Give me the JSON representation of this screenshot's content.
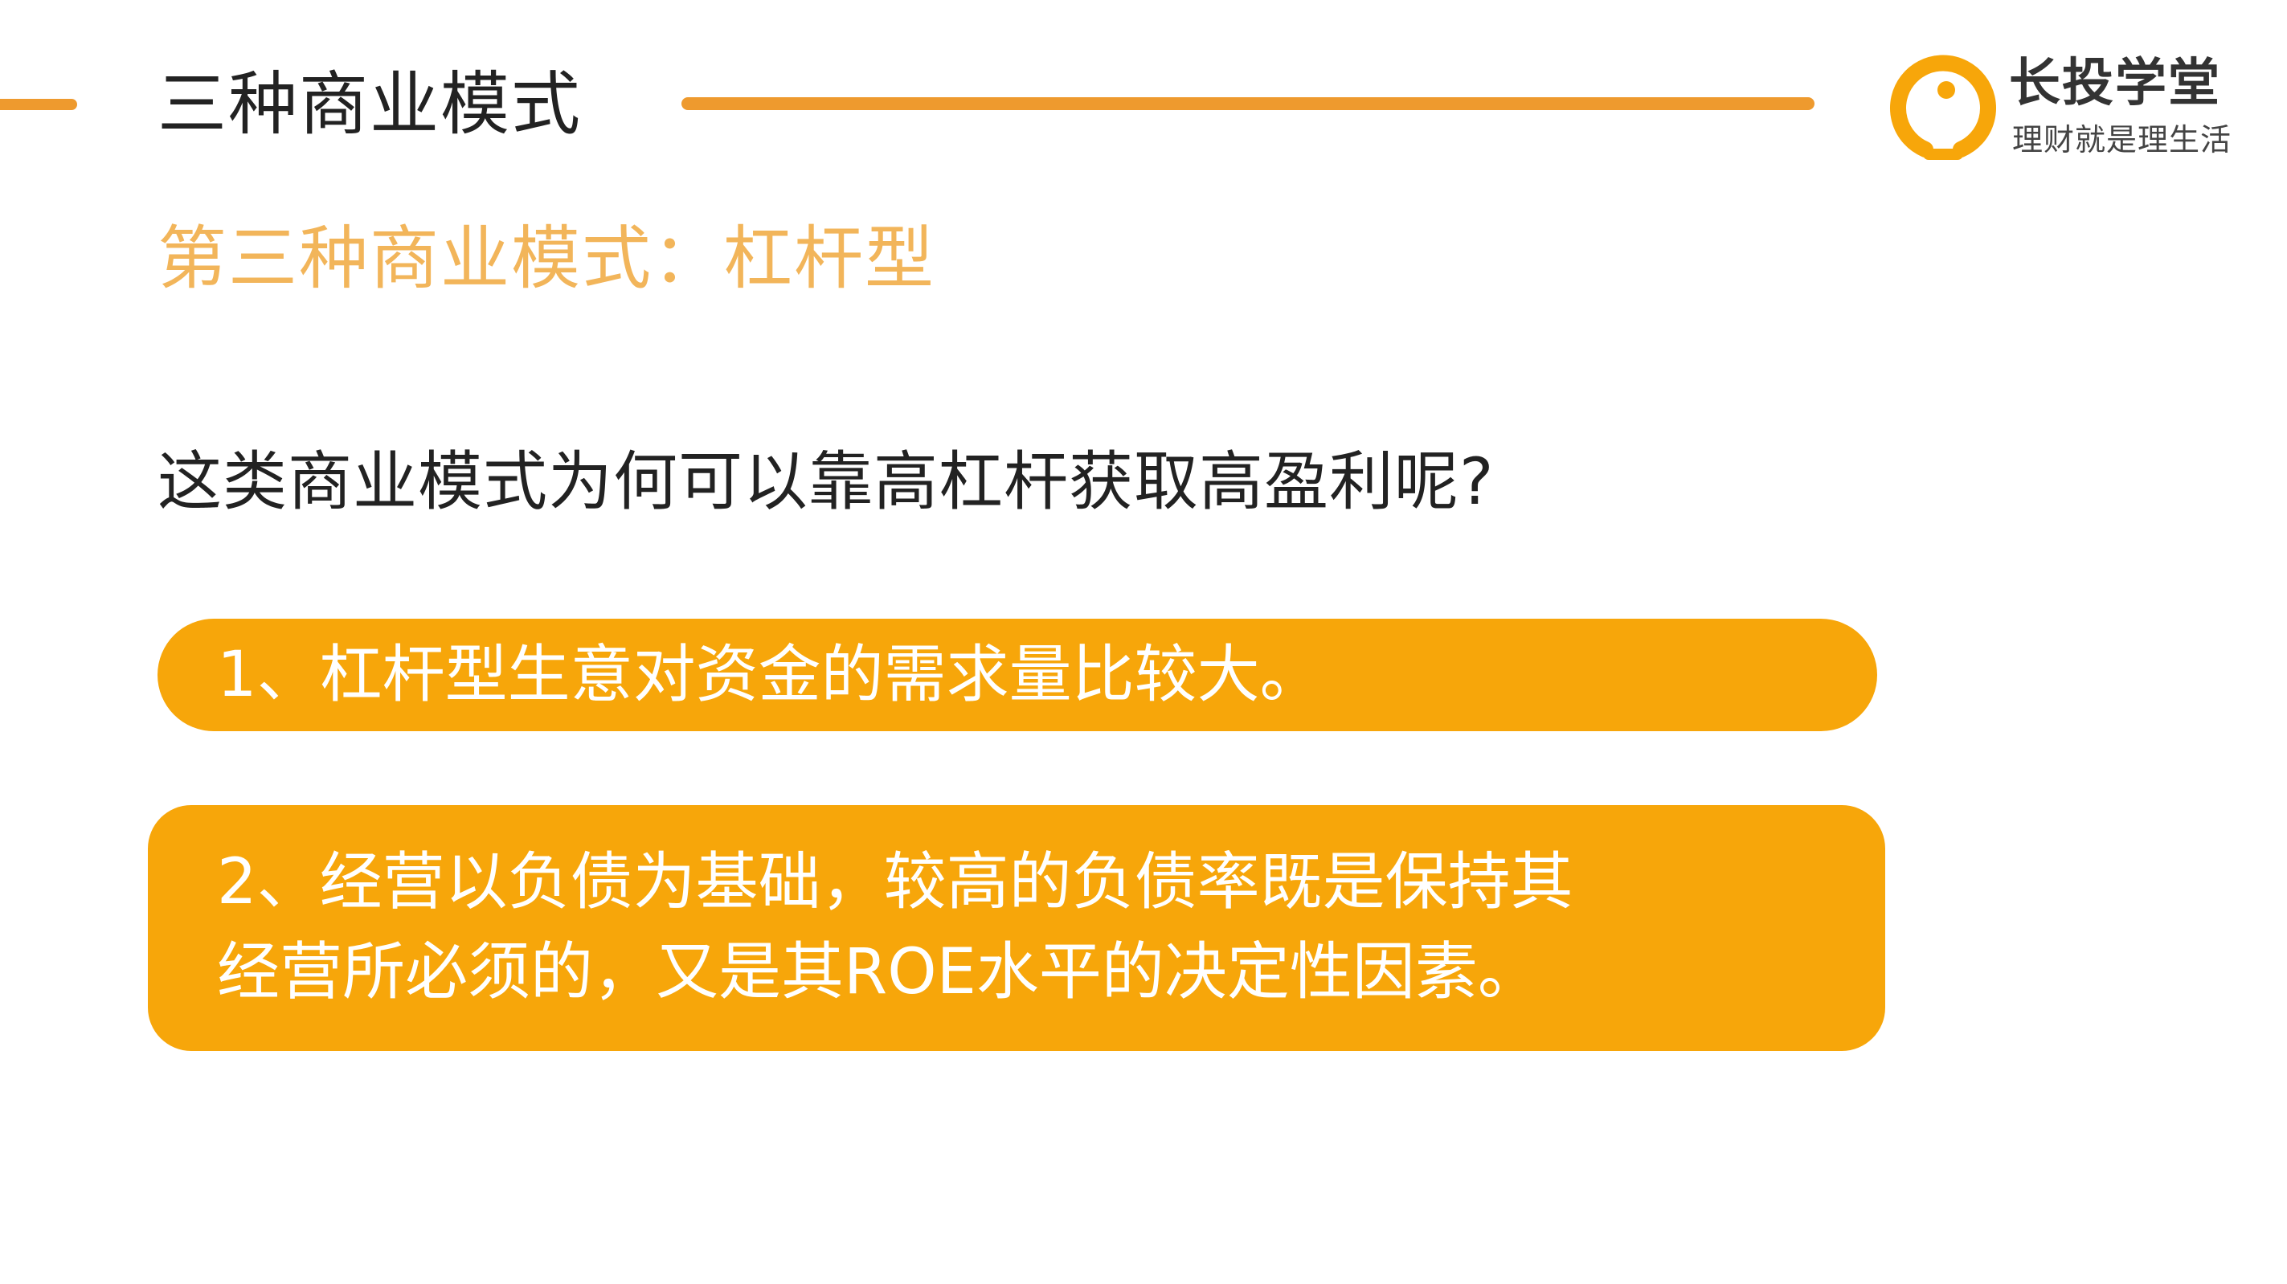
{
  "header": {
    "title": "三种商业模式",
    "accent_color": "#EE9A2E"
  },
  "logo": {
    "icon": "lightbulb-icon",
    "name": "长投学堂",
    "slogan": "理财就是理生活",
    "color": "#F7A60A"
  },
  "subtitle": "第三种商业模式：杠杆型",
  "question": "这类商业模式为何可以靠高杠杆获取高盈利呢?",
  "points": [
    {
      "lines": [
        "1、杠杆型生意对资金的需求量比较大。"
      ]
    },
    {
      "lines": [
        "2、经营以负债为基础，较高的负债率既是保持其",
        "经营所必须的，又是其ROE水平的决定性因素。"
      ]
    }
  ],
  "colors": {
    "pill_background": "#F7A60A",
    "subtitle_text": "#F2B55A",
    "body_text": "#222222"
  }
}
